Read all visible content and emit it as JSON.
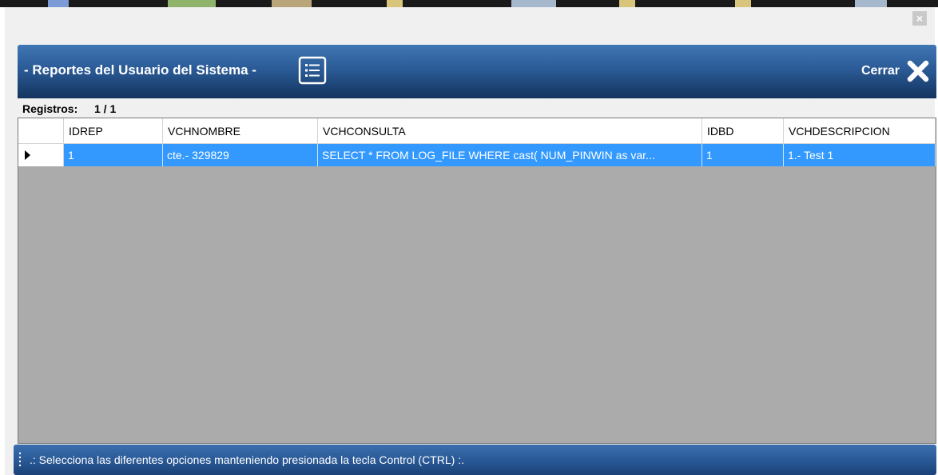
{
  "window": {
    "close_label": "×"
  },
  "header": {
    "title": "- Reportes del Usuario del Sistema -",
    "close_label": "Cerrar",
    "icons": [
      "list-icon",
      "close-x-icon"
    ]
  },
  "records": {
    "label": "Registros:",
    "value": "1 / 1"
  },
  "grid": {
    "columns": [
      "IDREP",
      "VCHNOMBRE",
      "VCHCONSULTA",
      "IDBD",
      "VCHDESCRIPCION"
    ],
    "rows": [
      {
        "idrep": "1",
        "vchnombre": "cte.- 329829",
        "vchconsulta": "SELECT * FROM LOG_FILE WHERE cast( NUM_PINWIN as var...",
        "idbd": "1",
        "vchdescripcion": "1.- Test 1"
      }
    ],
    "selection_color": "#3399ff",
    "background_color": "#ababab"
  },
  "status": {
    "text": ".: Selecciona las diferentes opciones manteniendo presionada la tecla Control (CTRL) :."
  },
  "colors": {
    "header_top": "#3f76b4",
    "header_bottom": "#13345f",
    "status_bar": "#2a5a97"
  }
}
